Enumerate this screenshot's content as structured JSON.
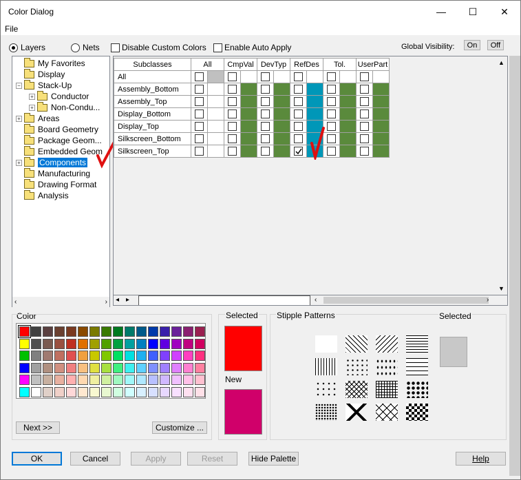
{
  "window": {
    "title": "Color Dialog",
    "min_glyph": "—",
    "max_glyph": "☐",
    "close_glyph": "✕"
  },
  "menu": {
    "file": "File"
  },
  "toolbar": {
    "layers_label": "Layers",
    "nets_label": "Nets",
    "disable_custom_colors": "Disable Custom Colors",
    "enable_auto_apply": "Enable Auto Apply",
    "global_visibility": "Global Visibility:",
    "on": "On",
    "off": "Off"
  },
  "tree": {
    "items": [
      {
        "label": "My Favorites"
      },
      {
        "label": "Display"
      },
      {
        "label": "Stack-Up"
      },
      {
        "label": "Conductor"
      },
      {
        "label": "Non-Condu..."
      },
      {
        "label": "Areas"
      },
      {
        "label": "Board Geometry"
      },
      {
        "label": "Package Geom..."
      },
      {
        "label": "Embedded Geom"
      },
      {
        "label": "Components"
      },
      {
        "label": "Manufacturing"
      },
      {
        "label": "Drawing Format"
      },
      {
        "label": "Analysis"
      }
    ]
  },
  "grid": {
    "headers": [
      "Subclasses",
      "All",
      "CmpVal",
      "DevTyp",
      "RefDes",
      "Tol.",
      "UserPart"
    ],
    "rows": [
      {
        "label": "All"
      },
      {
        "label": "Assembly_Bottom"
      },
      {
        "label": "Assembly_Top"
      },
      {
        "label": "Display_Bottom"
      },
      {
        "label": "Display_Top"
      },
      {
        "label": "Silkscreen_Bottom"
      },
      {
        "label": "Silkscreen_Top"
      }
    ],
    "column_colors": {
      "all": "#c0c0c0",
      "green": "#5a8a3c",
      "refdes": "#0097b8"
    },
    "checked_cell": "Silkscreen_Top / RefDes"
  },
  "palette": {
    "label": "Color",
    "next_button": "Next >>",
    "customize_button": "Customize ...",
    "rows": [
      [
        "#ff0000",
        "#404040",
        "#5a4040",
        "#6a4030",
        "#7a3a20",
        "#8a4a00",
        "#7a7a00",
        "#3a7a00",
        "#007a20",
        "#007a6a",
        "#005a8a",
        "#003aaa",
        "#3a20aa",
        "#6a209a",
        "#8a2070",
        "#9a2050"
      ],
      [
        "#ffff00",
        "#505050",
        "#7a5a50",
        "#9a5040",
        "#c03020",
        "#e07000",
        "#a0a000",
        "#50a000",
        "#00a040",
        "#00a0a0",
        "#0080c0",
        "#0000ff",
        "#6000e0",
        "#a000c0",
        "#c00080",
        "#d00060"
      ],
      [
        "#00c000",
        "#808080",
        "#a07a70",
        "#c07060",
        "#e05050",
        "#f0a040",
        "#c8c800",
        "#80c800",
        "#00e060",
        "#00e0e0",
        "#20b0f0",
        "#4060ff",
        "#8040ff",
        "#d040ff",
        "#ff40c0",
        "#ff3080"
      ],
      [
        "#0000ff",
        "#a0a0a0",
        "#b09080",
        "#d09080",
        "#f08080",
        "#f8c080",
        "#e0e040",
        "#a8e040",
        "#40f080",
        "#40f0f0",
        "#60d0ff",
        "#8090ff",
        "#a080ff",
        "#e080ff",
        "#ff80d0",
        "#ff80a0"
      ],
      [
        "#ff00ff",
        "#c0c0c0",
        "#c8b0a0",
        "#e8b0a0",
        "#ffb0b0",
        "#ffd8b0",
        "#f0f0a0",
        "#d0f0a0",
        "#a0f8c0",
        "#a0f8f8",
        "#b0e8ff",
        "#b8c0ff",
        "#d0b8ff",
        "#f0c0ff",
        "#ffc0e8",
        "#ffc0d0"
      ],
      [
        "#00ffff",
        "#ffffff",
        "#e0d0c8",
        "#f0d0c8",
        "#ffd8d8",
        "#ffe8d0",
        "#f8f8d0",
        "#e8f8d0",
        "#d0ffe0",
        "#d0ffff",
        "#d8f0ff",
        "#d8e0ff",
        "#e8d8ff",
        "#f8e0ff",
        "#ffe0f0",
        "#ffe0e8"
      ]
    ]
  },
  "selected": {
    "label": "Selected",
    "color": "#ff0000",
    "new_label": "New",
    "new_color": "#d0006a"
  },
  "stipple": {
    "label": "Stipple Patterns",
    "selected_label": "Selected"
  },
  "buttons": {
    "ok": "OK",
    "cancel": "Cancel",
    "apply": "Apply",
    "reset": "Reset",
    "hide_palette": "Hide Palette",
    "help": "Help"
  }
}
